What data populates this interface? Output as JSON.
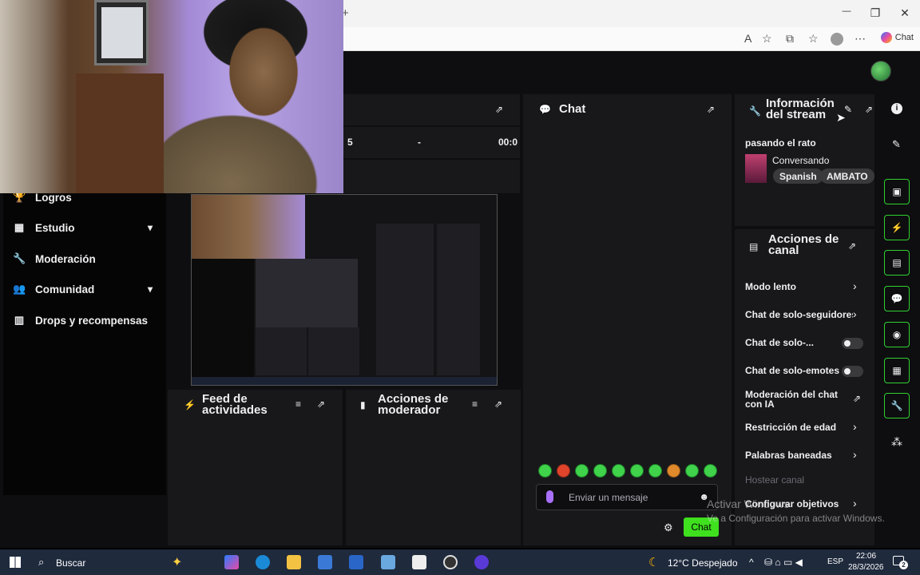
{
  "browser": {
    "new_tab_label": "+",
    "minimize": "—",
    "maximize": "❐",
    "close": "✕",
    "copilot_label": "Chat"
  },
  "sidebar": {
    "items": [
      {
        "label": "Logros",
        "icon": "trophy-icon",
        "has_chevron": false
      },
      {
        "label": "Estudio",
        "icon": "studio-icon",
        "has_chevron": true
      },
      {
        "label": "Moderación",
        "icon": "wrench-icon",
        "has_chevron": false
      },
      {
        "label": "Comunidad",
        "icon": "community-icon",
        "has_chevron": true
      },
      {
        "label": "Drops y recompensas",
        "icon": "drops-icon",
        "has_chevron": false
      }
    ]
  },
  "stats": {
    "viewers": "5",
    "followers": "-",
    "uptime": "00:0"
  },
  "chat": {
    "title": "Chat",
    "input_placeholder": "Enviar un mensaje",
    "send_label": "Chat"
  },
  "feed": {
    "title": "Feed de actividades"
  },
  "mod_actions": {
    "title": "Acciones de moderador"
  },
  "stream_info": {
    "title": "Información del stream",
    "stream_title": "pasando el rato",
    "category": "Conversando",
    "tags": [
      "Spanish",
      "AMBATO"
    ]
  },
  "channel_actions": {
    "title": "Acciones de canal",
    "items": [
      {
        "label": "Modo lento",
        "control": "chevron"
      },
      {
        "label": "Chat de solo-seguidores",
        "control": "chevron"
      },
      {
        "label": "Chat de solo-...",
        "control": "toggle"
      },
      {
        "label": "Chat de solo-emotes",
        "control": "toggle"
      },
      {
        "label": "Moderación del chat con IA",
        "control": "external"
      },
      {
        "label": "Restricción de edad",
        "control": "chevron"
      },
      {
        "label": "Palabras baneadas",
        "control": "chevron"
      },
      {
        "label": "Hostear canal",
        "control": "none"
      },
      {
        "label": "Configurar objetivos",
        "control": "chevron"
      }
    ]
  },
  "watermark": {
    "line1": "Activar Windows",
    "line2": "Ve a Configuración para activar Windows."
  },
  "taskbar": {
    "search_label": "Buscar",
    "weather": "12°C  Despejado",
    "language": "ESP",
    "time": "22:06",
    "date": "28/3/2026",
    "notification_count": "2"
  },
  "colors": {
    "accent": "#3fe01e",
    "panel": "#18181b",
    "background": "#0e0e10"
  }
}
